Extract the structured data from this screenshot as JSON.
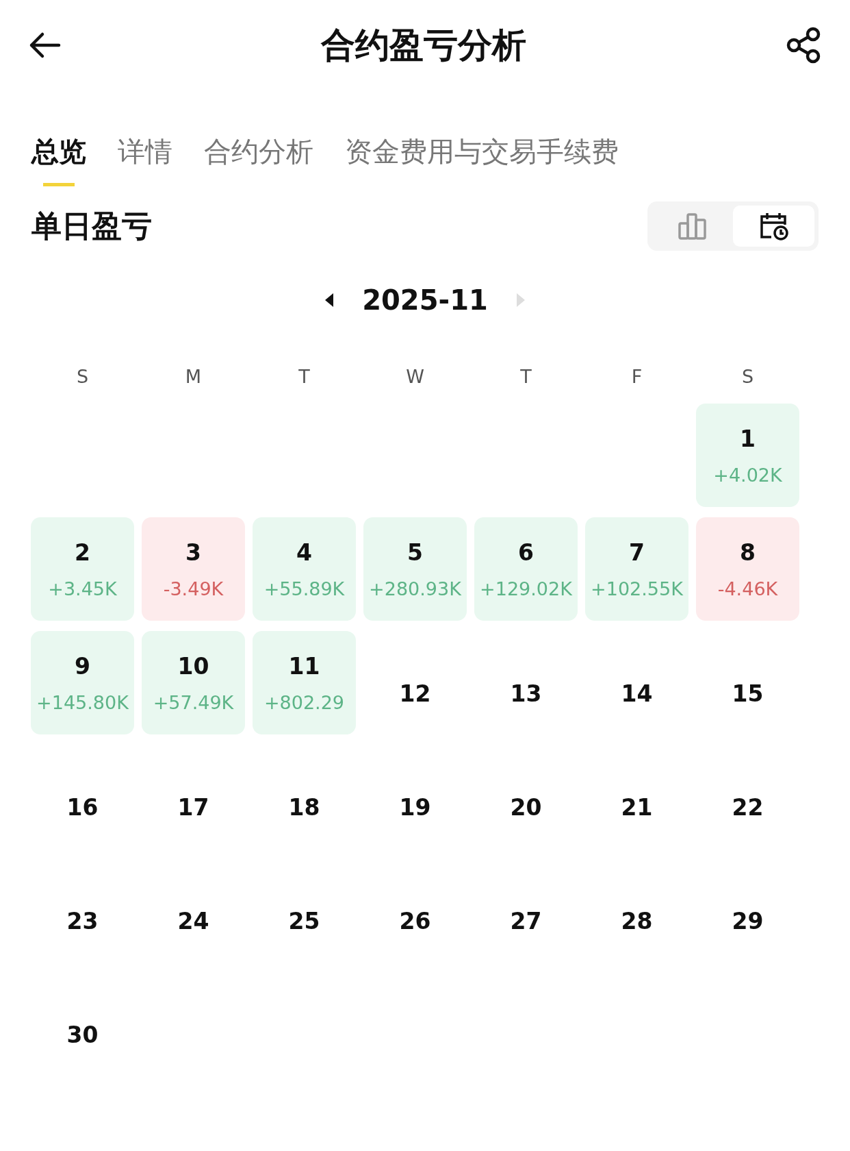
{
  "header": {
    "title": "合约盈亏分析"
  },
  "tabs": [
    {
      "label": "总览",
      "selected": true
    },
    {
      "label": "详情",
      "selected": false
    },
    {
      "label": "合约分析",
      "selected": false
    },
    {
      "label": "资金费用与交易手续费",
      "selected": false
    }
  ],
  "section": {
    "title": "单日盈亏"
  },
  "view_toggle": [
    {
      "kind": "chart",
      "selected": false
    },
    {
      "kind": "calendar",
      "selected": true
    }
  ],
  "month_nav": {
    "month": "2025-11",
    "prev": {
      "disabled": false
    },
    "next": {
      "disabled": true
    }
  },
  "weekdays": [
    "S",
    "M",
    "T",
    "W",
    "T",
    "F",
    "S"
  ],
  "weeks": [
    [
      {
        "kind": "blank"
      },
      {
        "kind": "blank"
      },
      {
        "kind": "blank"
      },
      {
        "kind": "blank"
      },
      {
        "kind": "blank"
      },
      {
        "kind": "blank"
      },
      {
        "kind": "profit",
        "day": "1",
        "pnl": "+4.02K"
      }
    ],
    [
      {
        "kind": "profit",
        "day": "2",
        "pnl": "+3.45K"
      },
      {
        "kind": "loss",
        "day": "3",
        "pnl": "-3.49K"
      },
      {
        "kind": "profit",
        "day": "4",
        "pnl": "+55.89K"
      },
      {
        "kind": "profit",
        "day": "5",
        "pnl": "+280.93K"
      },
      {
        "kind": "profit",
        "day": "6",
        "pnl": "+129.02K"
      },
      {
        "kind": "profit",
        "day": "7",
        "pnl": "+102.55K"
      },
      {
        "kind": "loss",
        "day": "8",
        "pnl": "-4.46K"
      }
    ],
    [
      {
        "kind": "profit",
        "day": "9",
        "pnl": "+145.80K"
      },
      {
        "kind": "profit",
        "day": "10",
        "pnl": "+57.49K"
      },
      {
        "kind": "profit",
        "day": "11",
        "pnl": "+802.29"
      },
      {
        "kind": "plain",
        "day": "12"
      },
      {
        "kind": "plain",
        "day": "13"
      },
      {
        "kind": "plain",
        "day": "14"
      },
      {
        "kind": "plain",
        "day": "15"
      }
    ],
    [
      {
        "kind": "plain",
        "day": "16"
      },
      {
        "kind": "plain",
        "day": "17"
      },
      {
        "kind": "plain",
        "day": "18"
      },
      {
        "kind": "plain",
        "day": "19"
      },
      {
        "kind": "plain",
        "day": "20"
      },
      {
        "kind": "plain",
        "day": "21"
      },
      {
        "kind": "plain",
        "day": "22"
      }
    ],
    [
      {
        "kind": "plain",
        "day": "23"
      },
      {
        "kind": "plain",
        "day": "24"
      },
      {
        "kind": "plain",
        "day": "25"
      },
      {
        "kind": "plain",
        "day": "26"
      },
      {
        "kind": "plain",
        "day": "27"
      },
      {
        "kind": "plain",
        "day": "28"
      },
      {
        "kind": "plain",
        "day": "29"
      }
    ],
    [
      {
        "kind": "plain",
        "day": "30"
      },
      {
        "kind": "blank"
      },
      {
        "kind": "blank"
      },
      {
        "kind": "blank"
      },
      {
        "kind": "blank"
      },
      {
        "kind": "blank"
      },
      {
        "kind": "blank"
      }
    ]
  ]
}
